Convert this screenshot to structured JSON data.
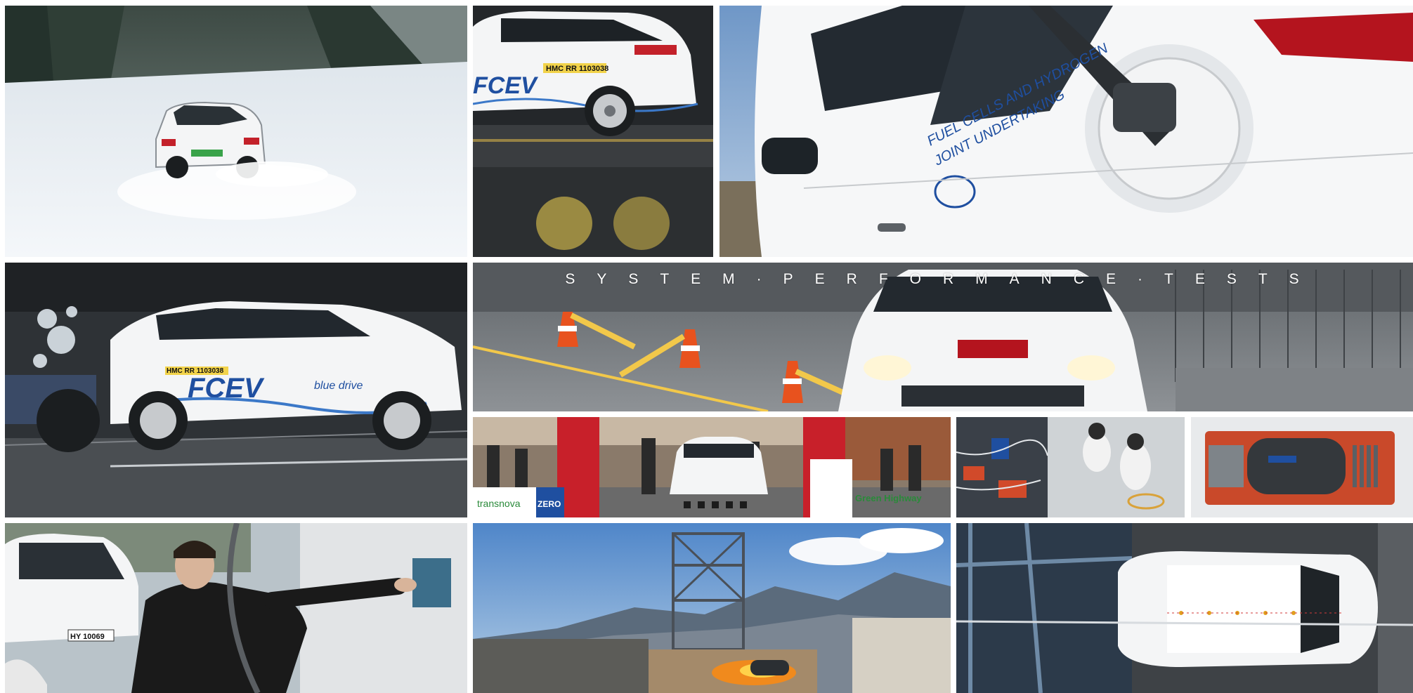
{
  "collage": {
    "title": "SYSTEM·PERFORMANCE·TESTS",
    "tiles": [
      {
        "name": "snow-driving-photo",
        "alt": "White SUV driving on snowy forest road"
      },
      {
        "name": "fcev-test-rig-photo",
        "alt": "FCEV car on test platform"
      },
      {
        "name": "refueling-photo",
        "alt": "Hydrogen nozzle refueling car"
      },
      {
        "name": "side-crash-photo",
        "alt": "Side impact crash test"
      },
      {
        "name": "system-performance-photo",
        "alt": "Car on slalom test course"
      },
      {
        "name": "public-event-photo",
        "alt": "Car at public hydrogen event"
      },
      {
        "name": "lab-work-photo",
        "alt": "Engineers in lab"
      },
      {
        "name": "fuel-cell-stack-photo",
        "alt": "Cutaway fuel cell stack"
      },
      {
        "name": "refuel-station-photo",
        "alt": "Man operating refueling station"
      },
      {
        "name": "fire-test-photo",
        "alt": "Tank bonfire test at mountain site"
      },
      {
        "name": "top-crash-photo",
        "alt": "Overhead crash test view"
      }
    ]
  },
  "labels": {
    "plate_top": "HMC RR 1103038",
    "fcev_logo": "FCEV",
    "blue_drive": "blue drive",
    "door_text_1": "FUEL CELLS AND HYDROGEN",
    "door_text_2": "JOINT UNDERTAKING",
    "plate_station": "HY 10069",
    "event_banner_1": "transnova",
    "event_banner_2": "ZERO",
    "event_banner_3": "Green Highway"
  },
  "colors": {
    "snow": "#eef2f6",
    "car_white": "#f4f5f6",
    "brand_blue": "#1f4fa0",
    "fire_orange": "#f08a1d"
  }
}
